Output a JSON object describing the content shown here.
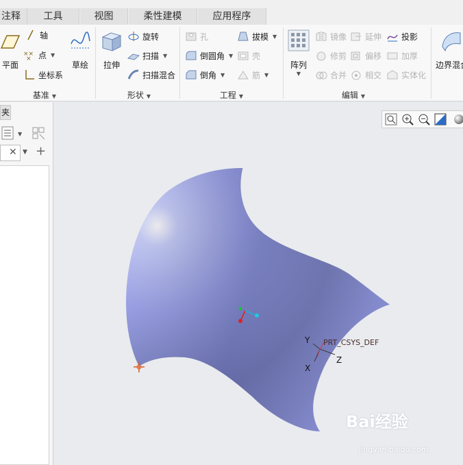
{
  "tabs": [
    {
      "label": "注释"
    },
    {
      "label": "工具"
    },
    {
      "label": "视图"
    },
    {
      "label": "柔性建模"
    },
    {
      "label": "应用程序"
    }
  ],
  "ribbon": {
    "datum": {
      "plane_label": "平面",
      "axis_label": "轴",
      "point_label": "点",
      "csys_label": "坐标系",
      "sketch_label": "草绘",
      "group_label": "基准"
    },
    "shapes": {
      "extrude_label": "拉伸",
      "revolve_label": "旋转",
      "sweep_label": "扫描",
      "swept_blend_label": "扫描混合",
      "group_label": "形状"
    },
    "engineering": {
      "hole_label": "孔",
      "round_label": "倒圆角",
      "chamfer_label": "倒角",
      "draft_label": "拔模",
      "shell_label": "壳",
      "rib_label": "筋",
      "group_label": "工程"
    },
    "editing": {
      "pattern_label": "阵列",
      "mirror_label": "镜像",
      "extend_label": "延伸",
      "project_label": "投影",
      "trim_label": "修剪",
      "offset_label": "偏移",
      "thicken_label": "加厚",
      "merge_label": "合并",
      "intersect_label": "相交",
      "solidify_label": "实体化",
      "group_label": "编辑"
    },
    "surfaces": {
      "boundary_blend_label": "边界混合"
    }
  },
  "left_panel": {
    "tab_label": "夹"
  },
  "graphics": {
    "csys_name": "PRT_CSYS_DEF",
    "axis_x": "X",
    "axis_y": "Y",
    "axis_z": "Z",
    "surface_color": "#a3aaf2",
    "watermark_main": "Bai经验",
    "watermark_sub": "jingyan.baidu.com"
  },
  "colors": {
    "ribbon_bg": "#f8f8f8",
    "tab_bg": "#e2e2e2",
    "canvas_bg": "#e9ebee",
    "accent_blue": "#2b6cc4"
  }
}
